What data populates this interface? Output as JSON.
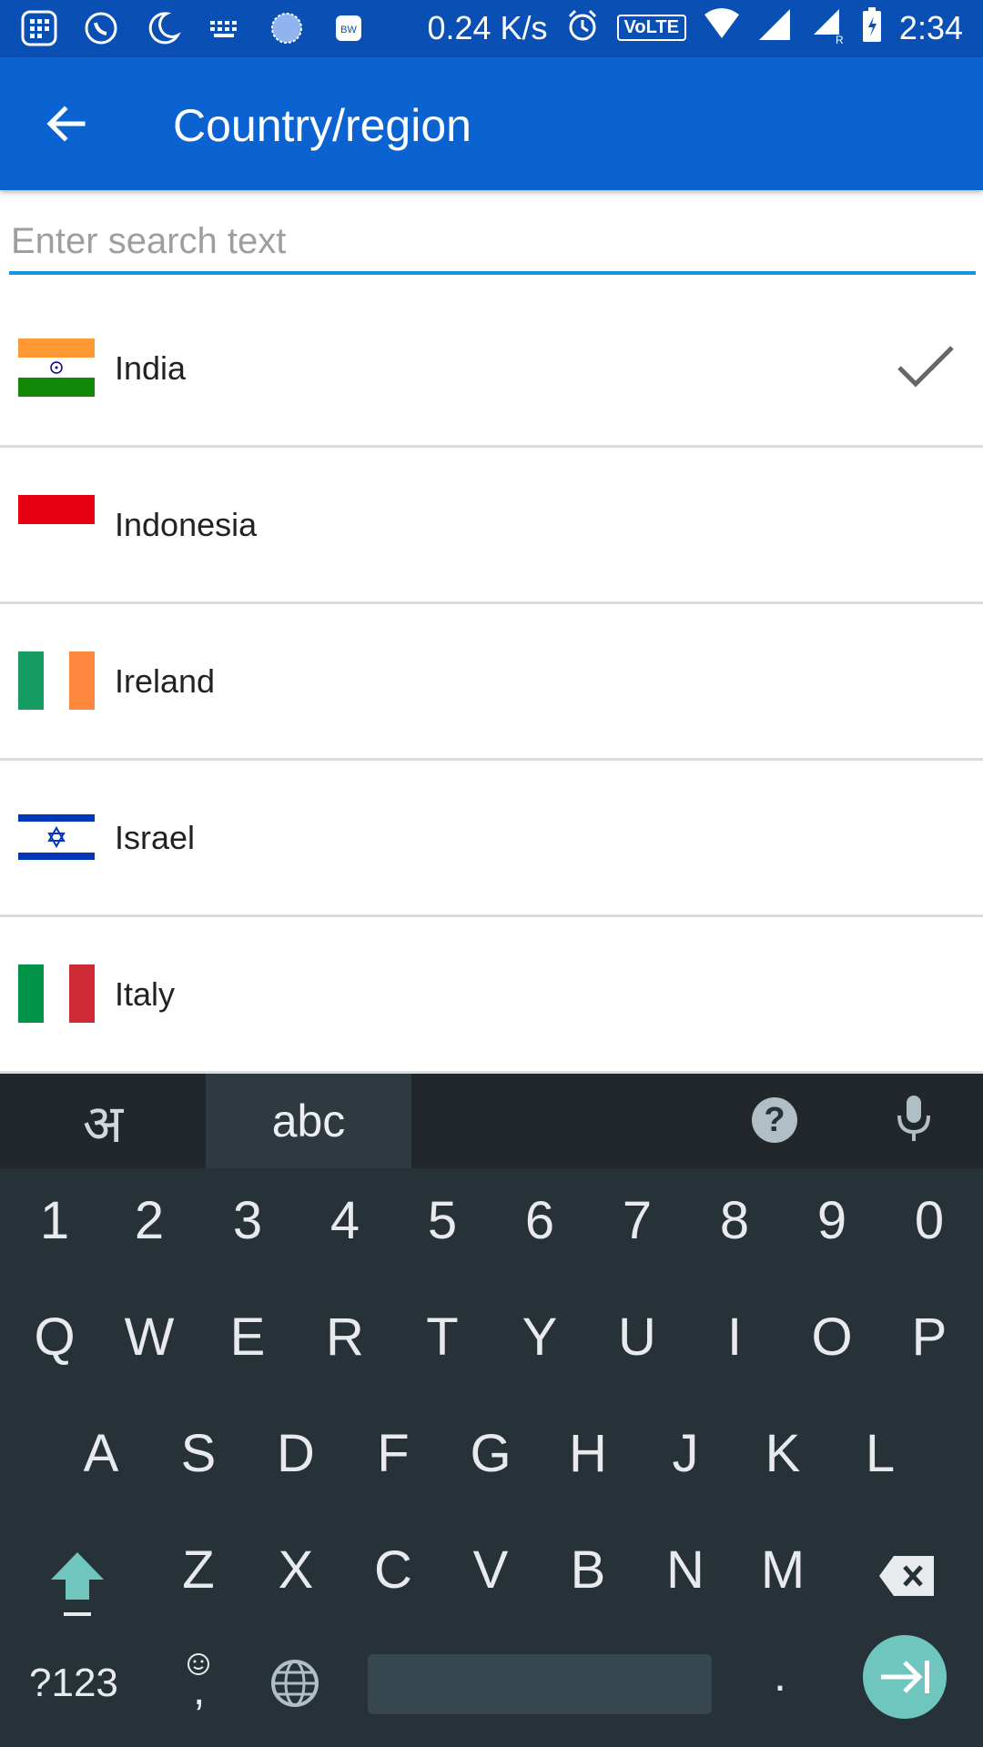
{
  "status_bar": {
    "net_speed": "0.24 K/s",
    "volte": "VoLTE",
    "time": "2:34",
    "left_icons": [
      "grid-app-icon",
      "whatsapp-icon",
      "moon-icon",
      "keyboard-icon",
      "circle-app-icon",
      "tag-app-icon"
    ],
    "right_icons": [
      "alarm-icon",
      "wifi-icon",
      "signal-icon",
      "signal-roaming-icon",
      "battery-icon"
    ]
  },
  "app_bar": {
    "title": "Country/region",
    "back_icon": "arrow-left-icon",
    "color": "#0a63d0"
  },
  "search": {
    "placeholder": "Enter search text",
    "value": ""
  },
  "countries": [
    {
      "name": "India",
      "selected": true
    },
    {
      "name": "Indonesia",
      "selected": false
    },
    {
      "name": "Ireland",
      "selected": false
    },
    {
      "name": "Israel",
      "selected": false
    },
    {
      "name": "Italy",
      "selected": false
    }
  ],
  "keyboard": {
    "lang_hindi": "अ",
    "lang_abc": "abc",
    "help": "?",
    "row_numbers": [
      "1",
      "2",
      "3",
      "4",
      "5",
      "6",
      "7",
      "8",
      "9",
      "0"
    ],
    "row_1": [
      "Q",
      "W",
      "E",
      "R",
      "T",
      "Y",
      "U",
      "I",
      "O",
      "P"
    ],
    "row_2": [
      "A",
      "S",
      "D",
      "F",
      "G",
      "H",
      "J",
      "K",
      "L"
    ],
    "row_3": [
      "Z",
      "X",
      "C",
      "V",
      "B",
      "N",
      "M"
    ],
    "symbols": "?123",
    "emoji_comma": ",",
    "period": ".",
    "accent": "#6ec6bf"
  }
}
